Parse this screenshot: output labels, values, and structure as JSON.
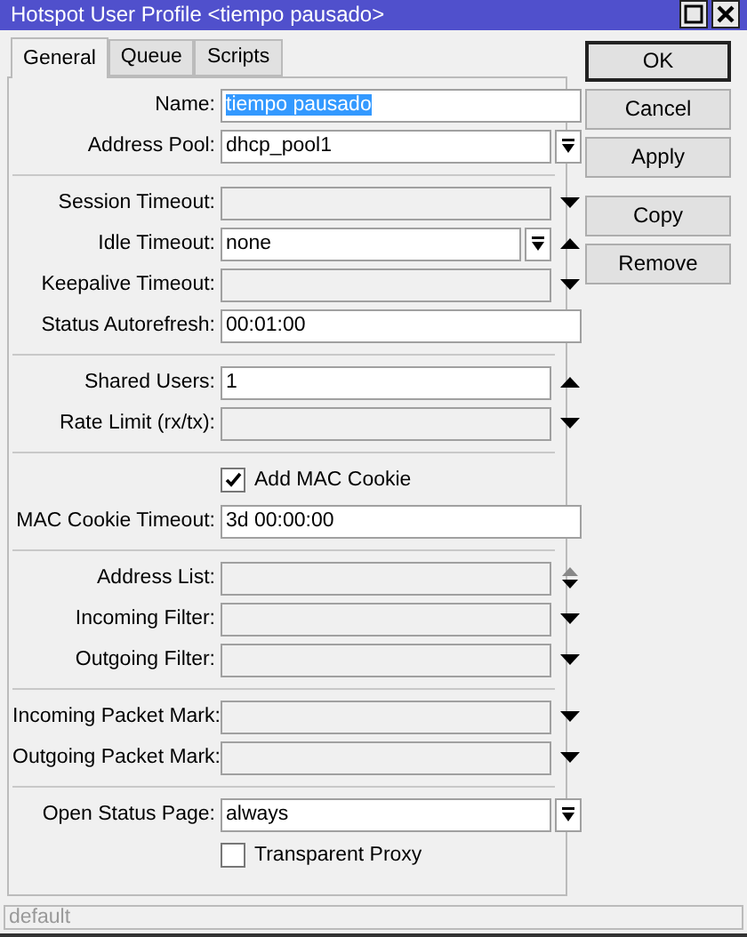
{
  "window": {
    "title": "Hotspot User Profile <tiempo pausado>"
  },
  "tabs": [
    {
      "label": "General",
      "selected": true
    },
    {
      "label": "Queue",
      "selected": false
    },
    {
      "label": "Scripts",
      "selected": false
    }
  ],
  "sections": [
    [
      {
        "kind": "field",
        "label": "Name:",
        "value": "tiempo pausado",
        "enabled": true,
        "highlighted": true,
        "dropdown": false
      },
      {
        "kind": "field",
        "label": "Address Pool:",
        "value": "dhcp_pool1",
        "enabled": true,
        "highlighted": false,
        "dropdown": true
      }
    ],
    [
      {
        "kind": "field",
        "label": "Session Timeout:",
        "enabled": false,
        "dropdown": false,
        "arrow": {
          "kind": "down"
        }
      },
      {
        "kind": "field",
        "label": "Idle Timeout:",
        "value": "none",
        "enabled": true,
        "highlighted": false,
        "dropdown": true,
        "arrow": {
          "kind": "up"
        }
      },
      {
        "kind": "field",
        "label": "Keepalive Timeout:",
        "enabled": false,
        "dropdown": false,
        "arrow": {
          "kind": "down"
        }
      },
      {
        "kind": "field",
        "label": "Status Autorefresh:",
        "value": "00:01:00",
        "enabled": true,
        "highlighted": false,
        "dropdown": false
      }
    ],
    [
      {
        "kind": "field",
        "label": "Shared Users:",
        "value": "1",
        "enabled": true,
        "highlighted": false,
        "dropdown": false,
        "arrow": {
          "kind": "up"
        }
      },
      {
        "kind": "field",
        "label": "Rate Limit (rx/tx):",
        "enabled": false,
        "dropdown": false,
        "arrow": {
          "kind": "down"
        }
      }
    ],
    [
      {
        "kind": "checkbox",
        "label": "Add MAC Cookie",
        "checked": true
      },
      {
        "kind": "field",
        "label": "MAC Cookie Timeout:",
        "value": "3d 00:00:00",
        "enabled": true,
        "highlighted": false,
        "dropdown": false
      }
    ],
    [
      {
        "kind": "field",
        "label": "Address List:",
        "enabled": false,
        "dropdown": false,
        "arrow": {
          "kind": "updown"
        }
      },
      {
        "kind": "field",
        "label": "Incoming Filter:",
        "enabled": false,
        "dropdown": false,
        "arrow": {
          "kind": "down"
        }
      },
      {
        "kind": "field",
        "label": "Outgoing Filter:",
        "enabled": false,
        "dropdown": false,
        "arrow": {
          "kind": "down"
        }
      }
    ],
    [
      {
        "kind": "field",
        "label": "Incoming Packet Mark:",
        "enabled": false,
        "dropdown": false,
        "arrow": {
          "kind": "down"
        }
      },
      {
        "kind": "field",
        "label": "Outgoing Packet Mark:",
        "enabled": false,
        "dropdown": false,
        "arrow": {
          "kind": "down"
        }
      }
    ],
    [
      {
        "kind": "field",
        "label": "Open Status Page:",
        "value": "always",
        "enabled": true,
        "highlighted": false,
        "dropdown": true
      },
      {
        "kind": "checkbox",
        "label": "Transparent Proxy",
        "checked": false
      }
    ]
  ],
  "buttons": [
    [
      {
        "label": "OK",
        "default": true
      },
      {
        "label": "Cancel",
        "default": false
      },
      {
        "label": "Apply",
        "default": false
      }
    ],
    [
      {
        "label": "Copy",
        "default": false
      },
      {
        "label": "Remove",
        "default": false
      }
    ]
  ],
  "status_bar": {
    "text": "default"
  }
}
